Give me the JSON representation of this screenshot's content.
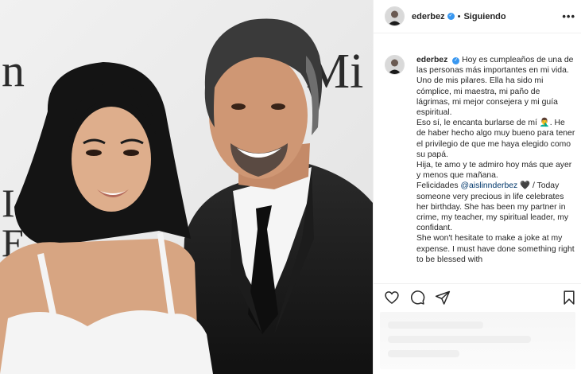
{
  "post": {
    "image_alt": "Photo of Eugenio Derbez and his daughter at a premiere",
    "backdrop_text": [
      "n",
      "Mi",
      "I",
      "E"
    ]
  },
  "header": {
    "username": "ederbez",
    "verified_icon": "verified-badge-icon",
    "separator": "•",
    "follow_status": "Siguiendo",
    "more_icon": "more-options-icon",
    "more_label": "•••"
  },
  "caption": {
    "username": "ederbez",
    "verified_mark": "✓",
    "text1": "Hoy es cumpleaños de una de las personas más importantes en mi vida. Uno de mis pilares. Ella ha sido mi cómplice, mi maestra, mi paño de lágrimas, mi mejor consejera y mi guía espiritual.",
    "text2": "Eso sí, le encanta burlarse de mí 🤦‍♂️. He de haber hecho algo muy bueno para tener el privilegio de que me haya elegido como su papá.",
    "text3": "Hija, te amo y te admiro hoy más que ayer y menos que mañana.",
    "text4_prefix": "Felicidades",
    "mention": "@aislinnderbez",
    "heart": "🖤",
    "text4_suffix": "/ Today someone very precious in life celebrates her birthday. She has been my partner in crime, my teacher, my spiritual leader, my confidant.",
    "text5": "She won't hesitate to make a joke at my expense. I must have done something right to be blessed with"
  },
  "actions": {
    "like_icon": "heart-icon",
    "comment_icon": "comment-icon",
    "share_icon": "send-icon",
    "save_icon": "bookmark-icon"
  }
}
